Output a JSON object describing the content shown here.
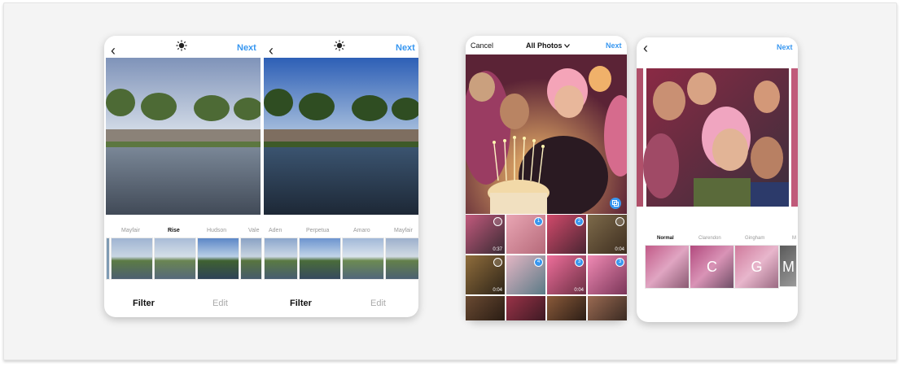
{
  "left_screen": {
    "next_label": "Next",
    "filters_a": [
      "Mayfair",
      "Rise",
      "Hudson",
      "Vale"
    ],
    "filters_b": [
      "Aden",
      "Perpetua",
      "Amaro",
      "Mayfair"
    ],
    "active_filter": "Rise",
    "tabs": [
      "Filter",
      "Edit",
      "Filter",
      "Edit"
    ]
  },
  "gallery_screen": {
    "cancel_label": "Cancel",
    "title": "All Photos",
    "next_label": "Next",
    "grid": [
      {
        "dur": "0:37",
        "badge": ""
      },
      {
        "dur": "",
        "badge": "1"
      },
      {
        "dur": "",
        "badge": "2"
      },
      {
        "dur": "0:04",
        "badge": ""
      },
      {
        "dur": "0:04",
        "badge": ""
      },
      {
        "dur": "",
        "badge": "4"
      },
      {
        "dur": "0:04",
        "badge": "3"
      },
      {
        "dur": "",
        "badge": "3"
      }
    ]
  },
  "filter_screen": {
    "next_label": "Next",
    "filters": [
      "Normal",
      "Clarendon",
      "Gingham",
      "M"
    ],
    "thumb_letters": [
      "",
      "C",
      "G",
      "M"
    ]
  },
  "icons": [
    "back-chevron-icon",
    "brightness-icon",
    "chevron-down-icon",
    "multi-select-icon"
  ],
  "colors": {
    "accent": "#3897f0",
    "stage": "#f4f4f4"
  }
}
